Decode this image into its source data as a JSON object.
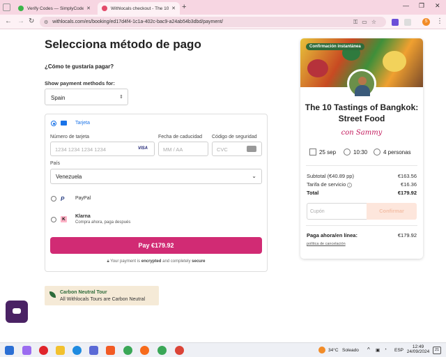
{
  "browser": {
    "tabs": [
      {
        "title": "Verify Codes — SimplyCodes",
        "active": false
      },
      {
        "title": "Withlocals checkout - The 10 T",
        "active": true
      }
    ],
    "url": "withlocals.com/es/booking/ed17d4f4-1c1a-402c-bac9-a24ab54b3dbd/payment/",
    "profile_initial": "S"
  },
  "page": {
    "title": "Selecciona método de pago",
    "question": "¿Cómo te gustaría pagar?",
    "show_methods_label": "Show payment methods for:",
    "country_selected": "Spain"
  },
  "payment": {
    "card": {
      "label": "Tarjeta",
      "number_label": "Número de tarjeta",
      "number_placeholder": "1234 1234 1234 1234",
      "brand": "VISA",
      "expiry_label": "Fecha de caducidad",
      "expiry_placeholder": "MM / AA",
      "cvc_label": "Código de seguridad",
      "cvc_placeholder": "CVC",
      "country_label": "País",
      "country_value": "Venezuela"
    },
    "paypal": {
      "label": "PayPal"
    },
    "klarna": {
      "label": "Klarna",
      "sublabel": "Compra ahora, paga después"
    },
    "pay_button": "Pay €179.92",
    "secure_pre": "Your payment is",
    "secure_enc": "encrypted",
    "secure_mid": "and completely",
    "secure_end": "secure"
  },
  "carbon": {
    "title": "Carbon Neutral Tour",
    "text": "All Withlocals Tours are Carbon Neutral"
  },
  "booking": {
    "badge": "Confirmación instantánea",
    "title": "The 10 Tastings of Bangkok: Street Food",
    "host": "con Sammy",
    "date": "25 sep",
    "time": "10:30",
    "people": "4 personas",
    "subtotal_label": "Subtotal (€40.89 pp)",
    "subtotal_value": "€163.56",
    "fee_label": "Tarifa de servicio",
    "fee_value": "€16.36",
    "total_label": "Total",
    "total_value": "€179.92",
    "coupon_placeholder": "Cupón",
    "coupon_button": "Confirmar",
    "pay_now_label": "Paga ahora/en línea:",
    "pay_now_value": "€179.92",
    "cancel_policy": "política de cancelación"
  },
  "taskbar": {
    "temp": "34°C",
    "weather": "Soleado",
    "lang": "ESP",
    "time": "12:49",
    "date": "24/09/2024",
    "notif": "21"
  }
}
